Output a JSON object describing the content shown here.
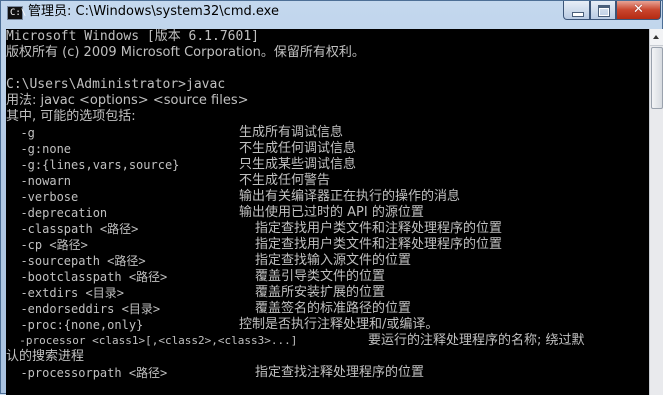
{
  "window": {
    "title": "管理员: C:\\Windows\\system32\\cmd.exe",
    "icon_label": "C:\\",
    "close_glyph": "✕"
  },
  "console": {
    "lines": [
      "Microsoft Windows [版本 6.1.7601]",
      "版权所有 (c) 2009 Microsoft Corporation。保留所有权利。",
      "",
      "C:\\Users\\Administrator>javac",
      "用法: javac <options> <source files>",
      "其中, 可能的选项包括:"
    ],
    "options": [
      {
        "flag": "  -g",
        "desc": "生成所有调试信息"
      },
      {
        "flag": "  -g:none",
        "desc": "不生成任何调试信息"
      },
      {
        "flag": "  -g:{lines,vars,source}",
        "desc": "只生成某些调试信息"
      },
      {
        "flag": "  -nowarn",
        "desc": "不生成任何警告"
      },
      {
        "flag": "  -verbose",
        "desc": "输出有关编译器正在执行的操作的消息"
      },
      {
        "flag": "  -deprecation",
        "desc": "输出使用已过时的 API 的源位置"
      },
      {
        "flag": "  -classpath <路径>",
        "desc": "指定查找用户类文件和注释处理程序的位置"
      },
      {
        "flag": "  -cp <路径>",
        "desc": "指定查找用户类文件和注释处理程序的位置"
      },
      {
        "flag": "  -sourcepath <路径>",
        "desc": "指定查找输入源文件的位置"
      },
      {
        "flag": "  -bootclasspath <路径>",
        "desc": "覆盖引导类文件的位置"
      },
      {
        "flag": "  -extdirs <目录>",
        "desc": "覆盖所安装扩展的位置"
      },
      {
        "flag": "  -endorseddirs <目录>",
        "desc": "覆盖签名的标准路径的位置"
      },
      {
        "flag": "  -proc:{none,only}",
        "desc": "控制是否执行注释处理和/或编译。"
      },
      {
        "flag": "  -processor <class1>[,<class2>,<class3>...]",
        "desc": "要运行的注释处理程序的名称; 绕过默"
      },
      {
        "flag": "",
        "desc": "认的搜索进程"
      },
      {
        "flag": "  -processorpath <路径>",
        "desc": "指定查找注释处理程序的位置"
      }
    ]
  },
  "colors": {
    "console_bg": "#000000",
    "console_fg": "#c0c0c0",
    "titlebar": "#b9cfea",
    "close_button": "#c9452d"
  }
}
